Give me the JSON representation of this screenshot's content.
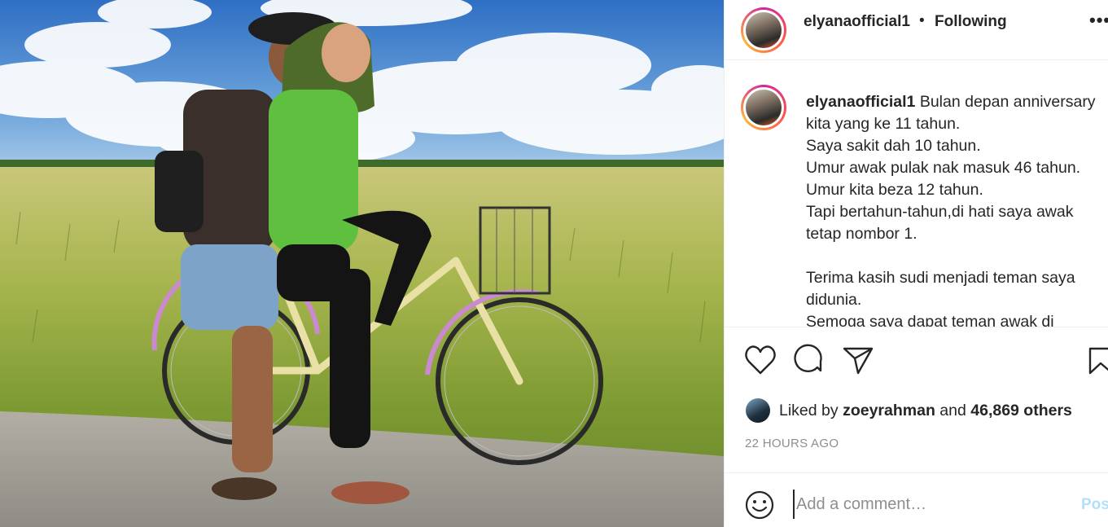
{
  "post": {
    "username": "elyanaofficial1",
    "separator": "•",
    "follow_status": "Following",
    "more_icon": "more-options-icon",
    "caption": "Bulan depan anniversary kita yang ke 11 tahun.\nSaya sakit dah 10 tahun.\nUmur awak pulak nak masuk 46 tahun.\nUmur kita beza 12 tahun.\nTapi bertahun-tahun,di hati saya awak tetap nombor 1.\n\nTerima kasih sudi menjadi teman saya didunia.\nSemoga saya dapat teman awak di",
    "likes": {
      "prefix": "Liked by",
      "user": "zoeyrahman",
      "conj": "and",
      "others": "46,869 others"
    },
    "time_ago": "22 HOURS AGO",
    "comment": {
      "placeholder": "Add a comment…",
      "post_label": "Post"
    }
  },
  "colors": {
    "link_blue_disabled": "#b2dffc",
    "muted_text": "#8e8e8e",
    "text": "#262626"
  },
  "icons": [
    "heart-icon",
    "comment-icon",
    "share-icon",
    "bookmark-icon",
    "emoji-icon"
  ]
}
